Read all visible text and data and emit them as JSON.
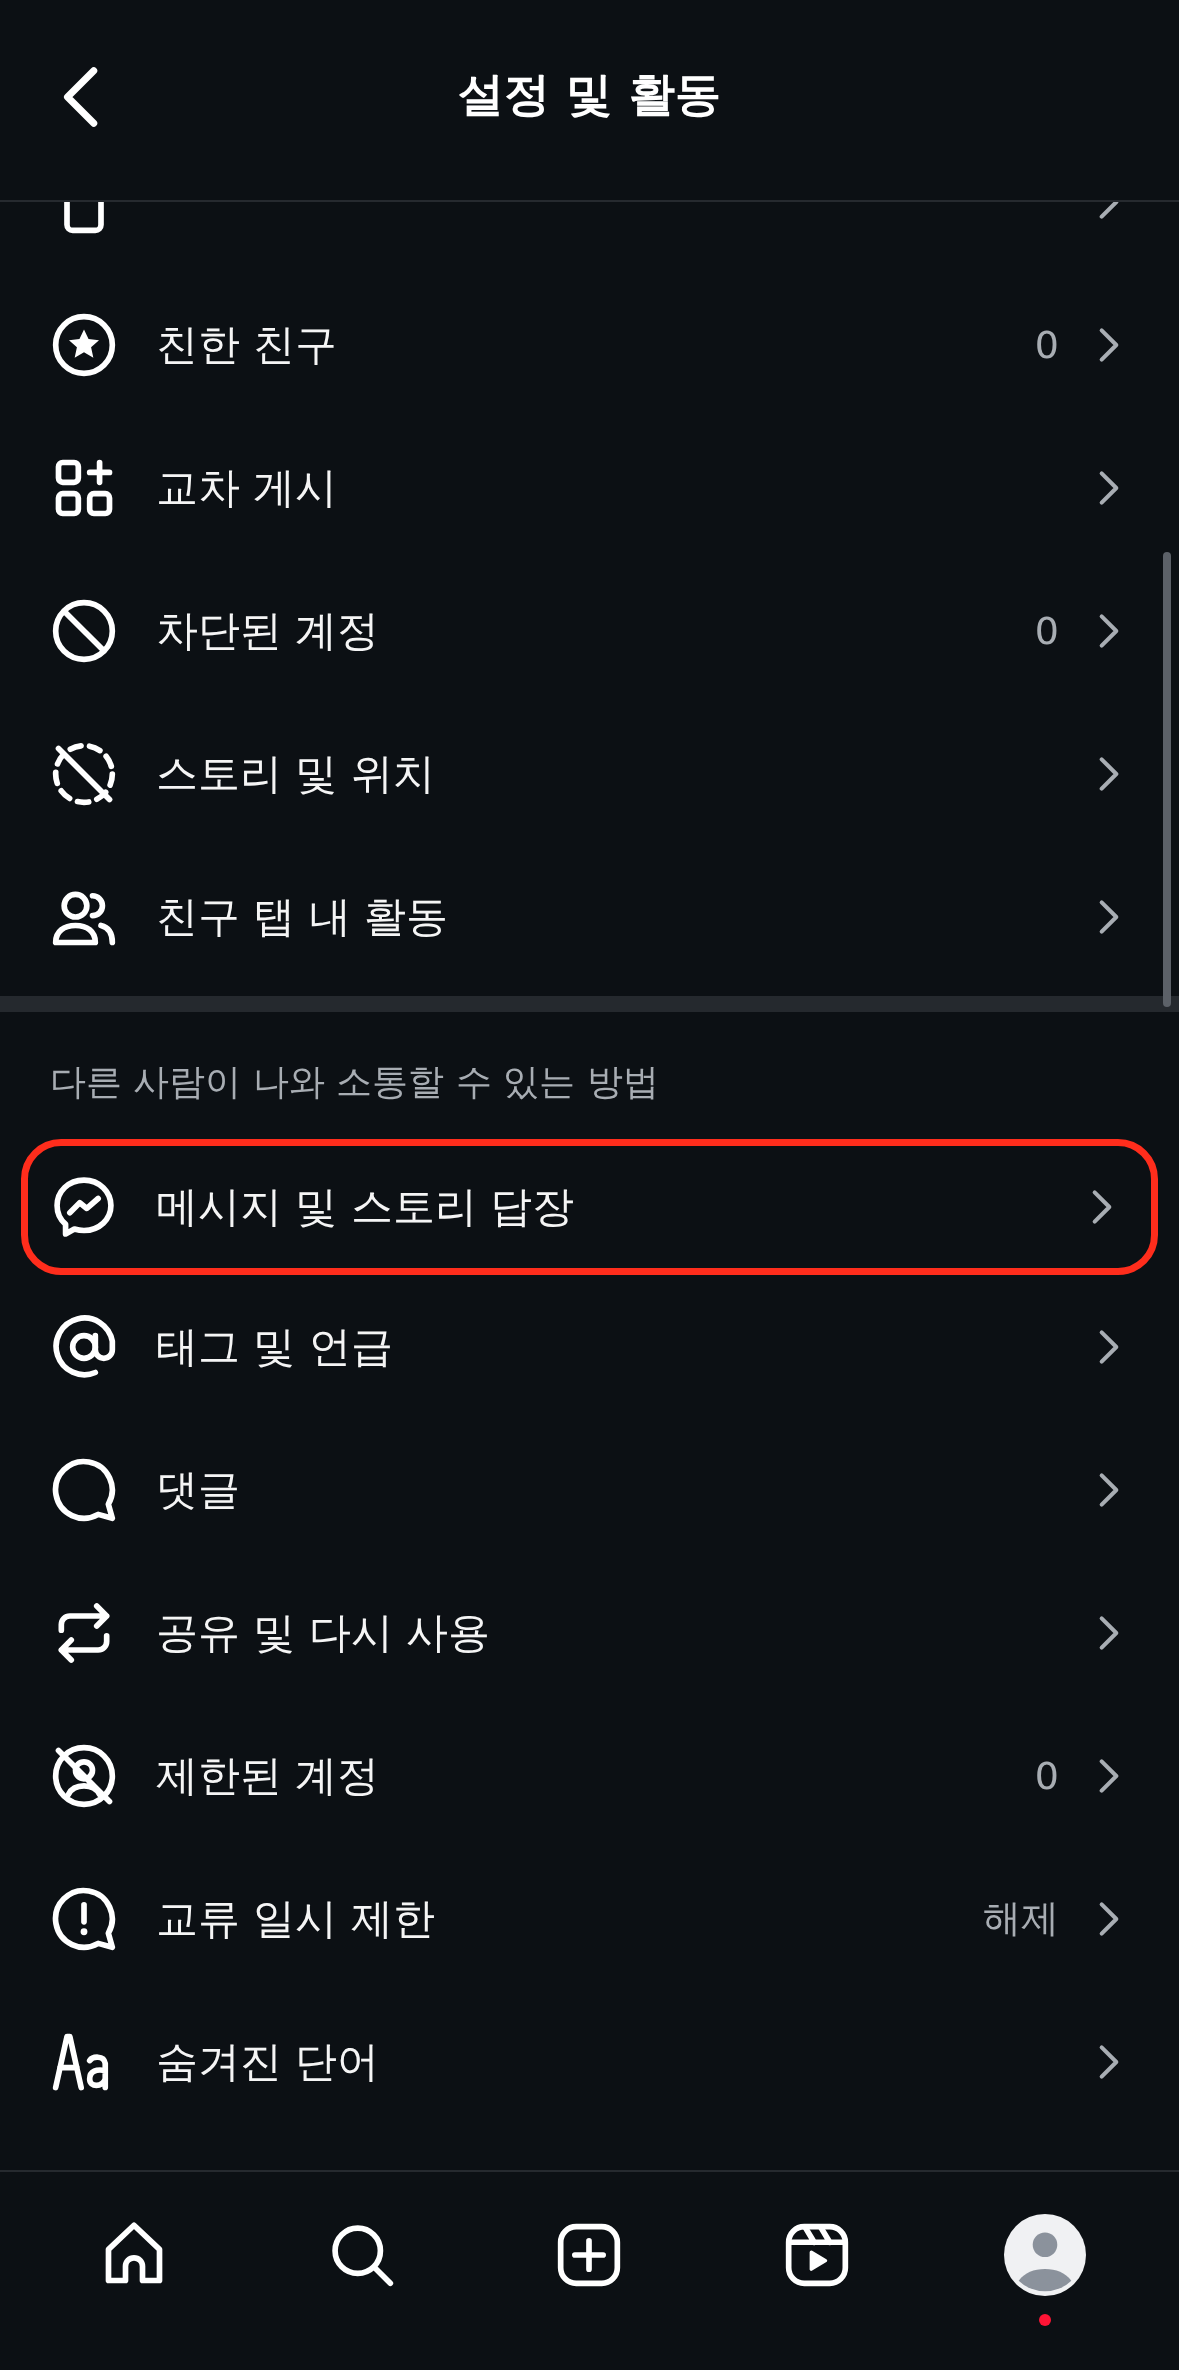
{
  "header": {
    "title": "설정 및 활동"
  },
  "list": [
    {
      "kind": "partial",
      "highlighted": false
    },
    {
      "kind": "item",
      "label": "친한 친구",
      "value": "0",
      "highlighted": false
    },
    {
      "kind": "item",
      "label": "교차 게시",
      "highlighted": false
    },
    {
      "kind": "item",
      "label": "차단된 계정",
      "value": "0",
      "highlighted": false
    },
    {
      "kind": "item",
      "label": "스토리 및 위치",
      "highlighted": false
    },
    {
      "kind": "item",
      "label": "친구 탭 내 활동",
      "highlighted": false
    },
    {
      "kind": "divider"
    },
    {
      "kind": "section",
      "label": "다른 사람이 나와 소통할 수 있는 방법"
    },
    {
      "kind": "item",
      "label": "메시지 및 스토리 답장",
      "highlighted": true
    },
    {
      "kind": "item",
      "label": "태그 및 언급",
      "highlighted": false
    },
    {
      "kind": "item",
      "label": "댓글",
      "highlighted": false
    },
    {
      "kind": "item",
      "label": "공유 및 다시 사용",
      "highlighted": false
    },
    {
      "kind": "item",
      "label": "제한된 계정",
      "value": "0",
      "highlighted": false
    },
    {
      "kind": "item",
      "label": "교류 일시 제한",
      "value": "해제",
      "highlighted": false
    },
    {
      "kind": "item",
      "label": "숨겨진 단어",
      "highlighted": false
    }
  ],
  "nav": {
    "profile_notification": true
  }
}
